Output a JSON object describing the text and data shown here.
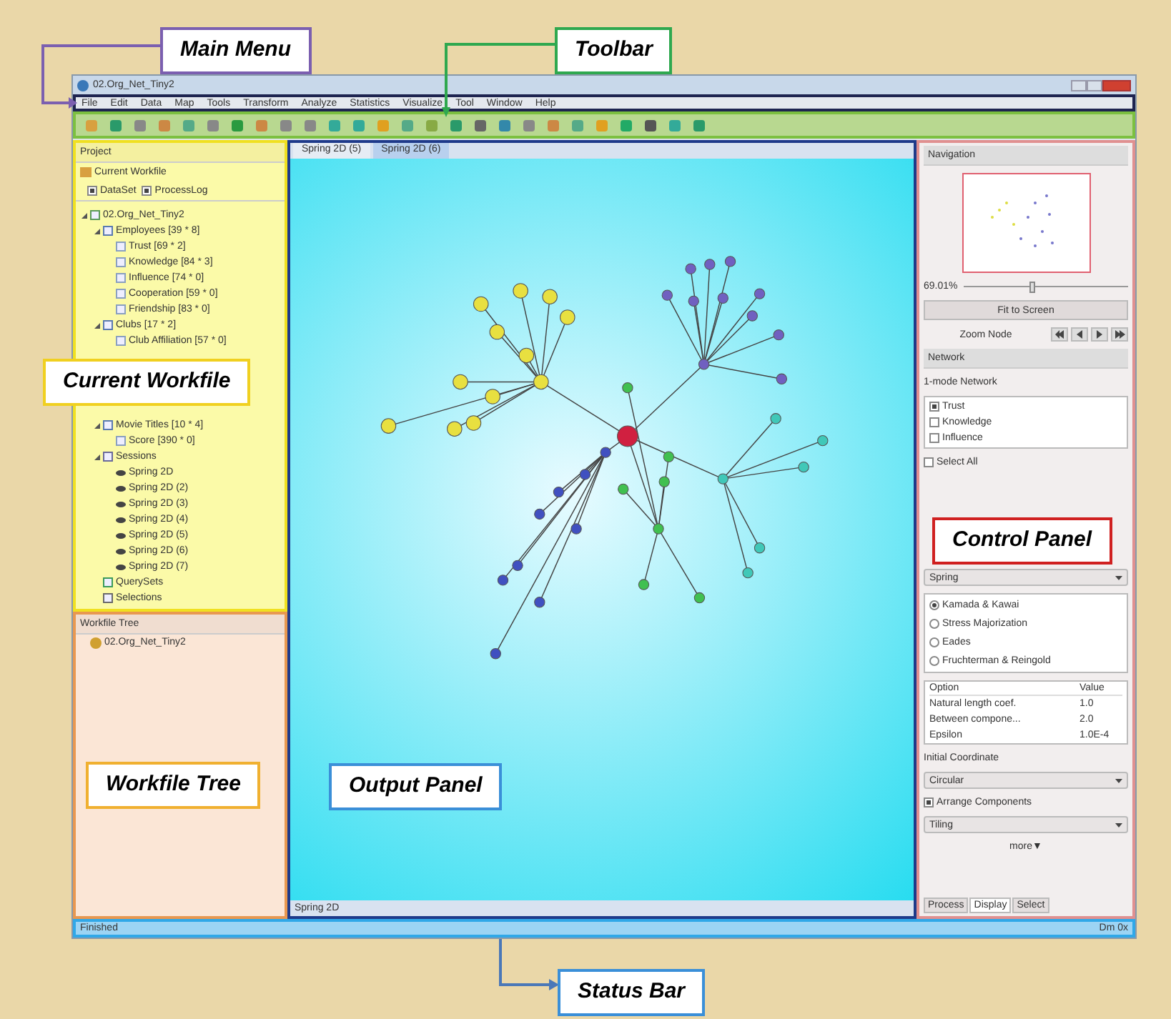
{
  "annotations": [
    {
      "label": "Main Menu",
      "color": "#7b5fb0",
      "kind": "menu"
    },
    {
      "label": "Toolbar",
      "color": "#2fa84f",
      "kind": "toolbar"
    },
    {
      "label": "Current Workfile",
      "color": "#f0d020",
      "kind": "workfile"
    },
    {
      "label": "Workfile Tree",
      "color": "#f0b030",
      "kind": "tree"
    },
    {
      "label": "Output Panel",
      "color": "#3a8fd8",
      "kind": "output"
    },
    {
      "label": "Control Panel",
      "color": "#d02020",
      "kind": "control"
    },
    {
      "label": "Status Bar",
      "color": "#3a8fd8",
      "kind": "status"
    }
  ],
  "window": {
    "title": "02.Org_Net_Tiny2"
  },
  "menu": [
    "File",
    "Edit",
    "Data",
    "Map",
    "Tools",
    "Transform",
    "Analyze",
    "Statistics",
    "Visualize",
    "Tool",
    "Window",
    "Help"
  ],
  "project_panel": {
    "title": "Project",
    "workfile_label": "Current Workfile",
    "checks": [
      {
        "label": "DataSet",
        "checked": true
      },
      {
        "label": "ProcessLog",
        "checked": true
      }
    ],
    "tree": [
      {
        "label": "02.Org_Net_Tiny2",
        "kind": "workfile",
        "children": [
          {
            "label": "Employees [39 * 8]",
            "kind": "set",
            "children": [
              {
                "label": "Trust [69 * 2]",
                "kind": "layer"
              },
              {
                "label": "Knowledge [84 * 3]",
                "kind": "layer"
              },
              {
                "label": "Influence [74 * 0]",
                "kind": "layer"
              },
              {
                "label": "Cooperation [59 * 0]",
                "kind": "layer"
              },
              {
                "label": "Friendship [83 * 0]",
                "kind": "layer"
              }
            ]
          },
          {
            "label": "Clubs [17 * 2]",
            "kind": "set",
            "children": [
              {
                "label": "Club Affiliation [57 * 0]",
                "kind": "layer"
              }
            ]
          },
          {
            "label": "Movie Titles [10 * 4]",
            "kind": "set",
            "children": [
              {
                "label": "Score [390 * 0]",
                "kind": "layer"
              }
            ]
          },
          {
            "label": "Sessions",
            "kind": "sessions",
            "children": [
              {
                "label": "Spring 2D",
                "kind": "session"
              },
              {
                "label": "Spring 2D (2)",
                "kind": "session"
              },
              {
                "label": "Spring 2D (3)",
                "kind": "session"
              },
              {
                "label": "Spring 2D (4)",
                "kind": "session"
              },
              {
                "label": "Spring 2D (5)",
                "kind": "session"
              },
              {
                "label": "Spring 2D (6)",
                "kind": "session"
              },
              {
                "label": "Spring 2D (7)",
                "kind": "session"
              }
            ]
          },
          {
            "label": "QuerySets",
            "kind": "queryset"
          },
          {
            "label": "Selections",
            "kind": "selection"
          }
        ]
      }
    ]
  },
  "workfile_tree": {
    "title": "Workfile Tree",
    "items": [
      "02.Org_Net_Tiny2"
    ]
  },
  "output_panel": {
    "tabs": [
      {
        "label": "Spring 2D (5)",
        "selected": false
      },
      {
        "label": "Spring 2D (6)",
        "selected": true
      }
    ],
    "bottom_tab": "Spring 2D"
  },
  "control_panel": {
    "navigation": {
      "title": "Navigation",
      "zoom": "69.01%",
      "level": 0.4,
      "fit_button": "Fit to Screen",
      "zoom_node_label": "Zoom Node"
    },
    "network": {
      "title": "Network",
      "mode_label": "1-mode Network",
      "layers": [
        {
          "label": "Trust",
          "checked": true
        },
        {
          "label": "Knowledge",
          "checked": false
        },
        {
          "label": "Influence",
          "checked": false
        }
      ],
      "select_all": {
        "label": "Select All",
        "checked": false
      }
    },
    "layout": {
      "algorithm": "Spring",
      "methods": [
        {
          "label": "Kamada & Kawai",
          "selected": true
        },
        {
          "label": "Stress Majorization",
          "selected": false
        },
        {
          "label": "Eades",
          "selected": false
        },
        {
          "label": "Fruchterman & Reingold",
          "selected": false
        }
      ],
      "option_columns": [
        "Option",
        "Value"
      ],
      "options": [
        [
          "Natural length coef.",
          "1.0"
        ],
        [
          "Between compone...",
          "2.0"
        ],
        [
          "Epsilon",
          "1.0E-4"
        ]
      ],
      "initial_label": "Initial Coordinate",
      "initial": "Circular",
      "arrange": {
        "label": "Arrange Components",
        "checked": true
      },
      "arrange_value": "Tiling",
      "more": "more▼"
    },
    "tabs": [
      {
        "label": "Process",
        "selected": false
      },
      {
        "label": "Display",
        "selected": true
      },
      {
        "label": "Select",
        "selected": false
      }
    ]
  },
  "status_bar": {
    "text": "Finished",
    "right": "Dm 0x"
  }
}
